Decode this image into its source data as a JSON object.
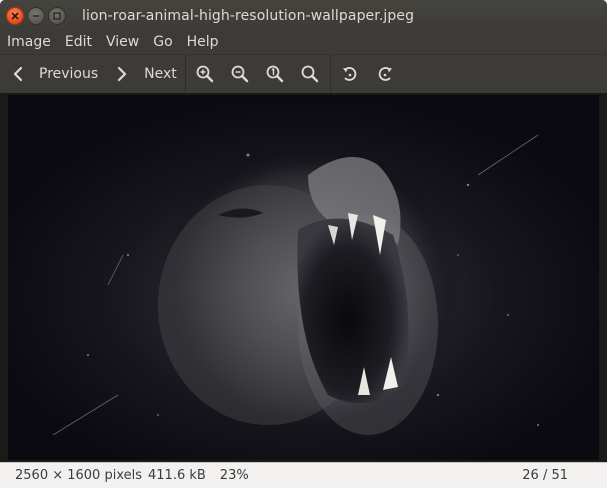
{
  "window": {
    "title": "lion-roar-animal-high-resolution-wallpaper.jpeg"
  },
  "menu": {
    "items": [
      "Image",
      "Edit",
      "View",
      "Go",
      "Help"
    ]
  },
  "toolbar": {
    "previous_label": "Previous",
    "next_label": "Next",
    "icons": [
      "zoom-in-icon",
      "zoom-out-icon",
      "zoom-normal-icon",
      "zoom-fit-icon",
      "rotate-left-icon",
      "rotate-right-icon"
    ]
  },
  "image": {
    "description_icon": "lion-roar-photo"
  },
  "status": {
    "dimensions": "2560 × 1600 pixels",
    "filesize": "411.6 kB",
    "zoom": "23%",
    "position": "26 / 51"
  },
  "colors": {
    "close_button": "#e2491c",
    "titlebar_bg": "#3c3b37",
    "text": "#dfdbd2"
  }
}
